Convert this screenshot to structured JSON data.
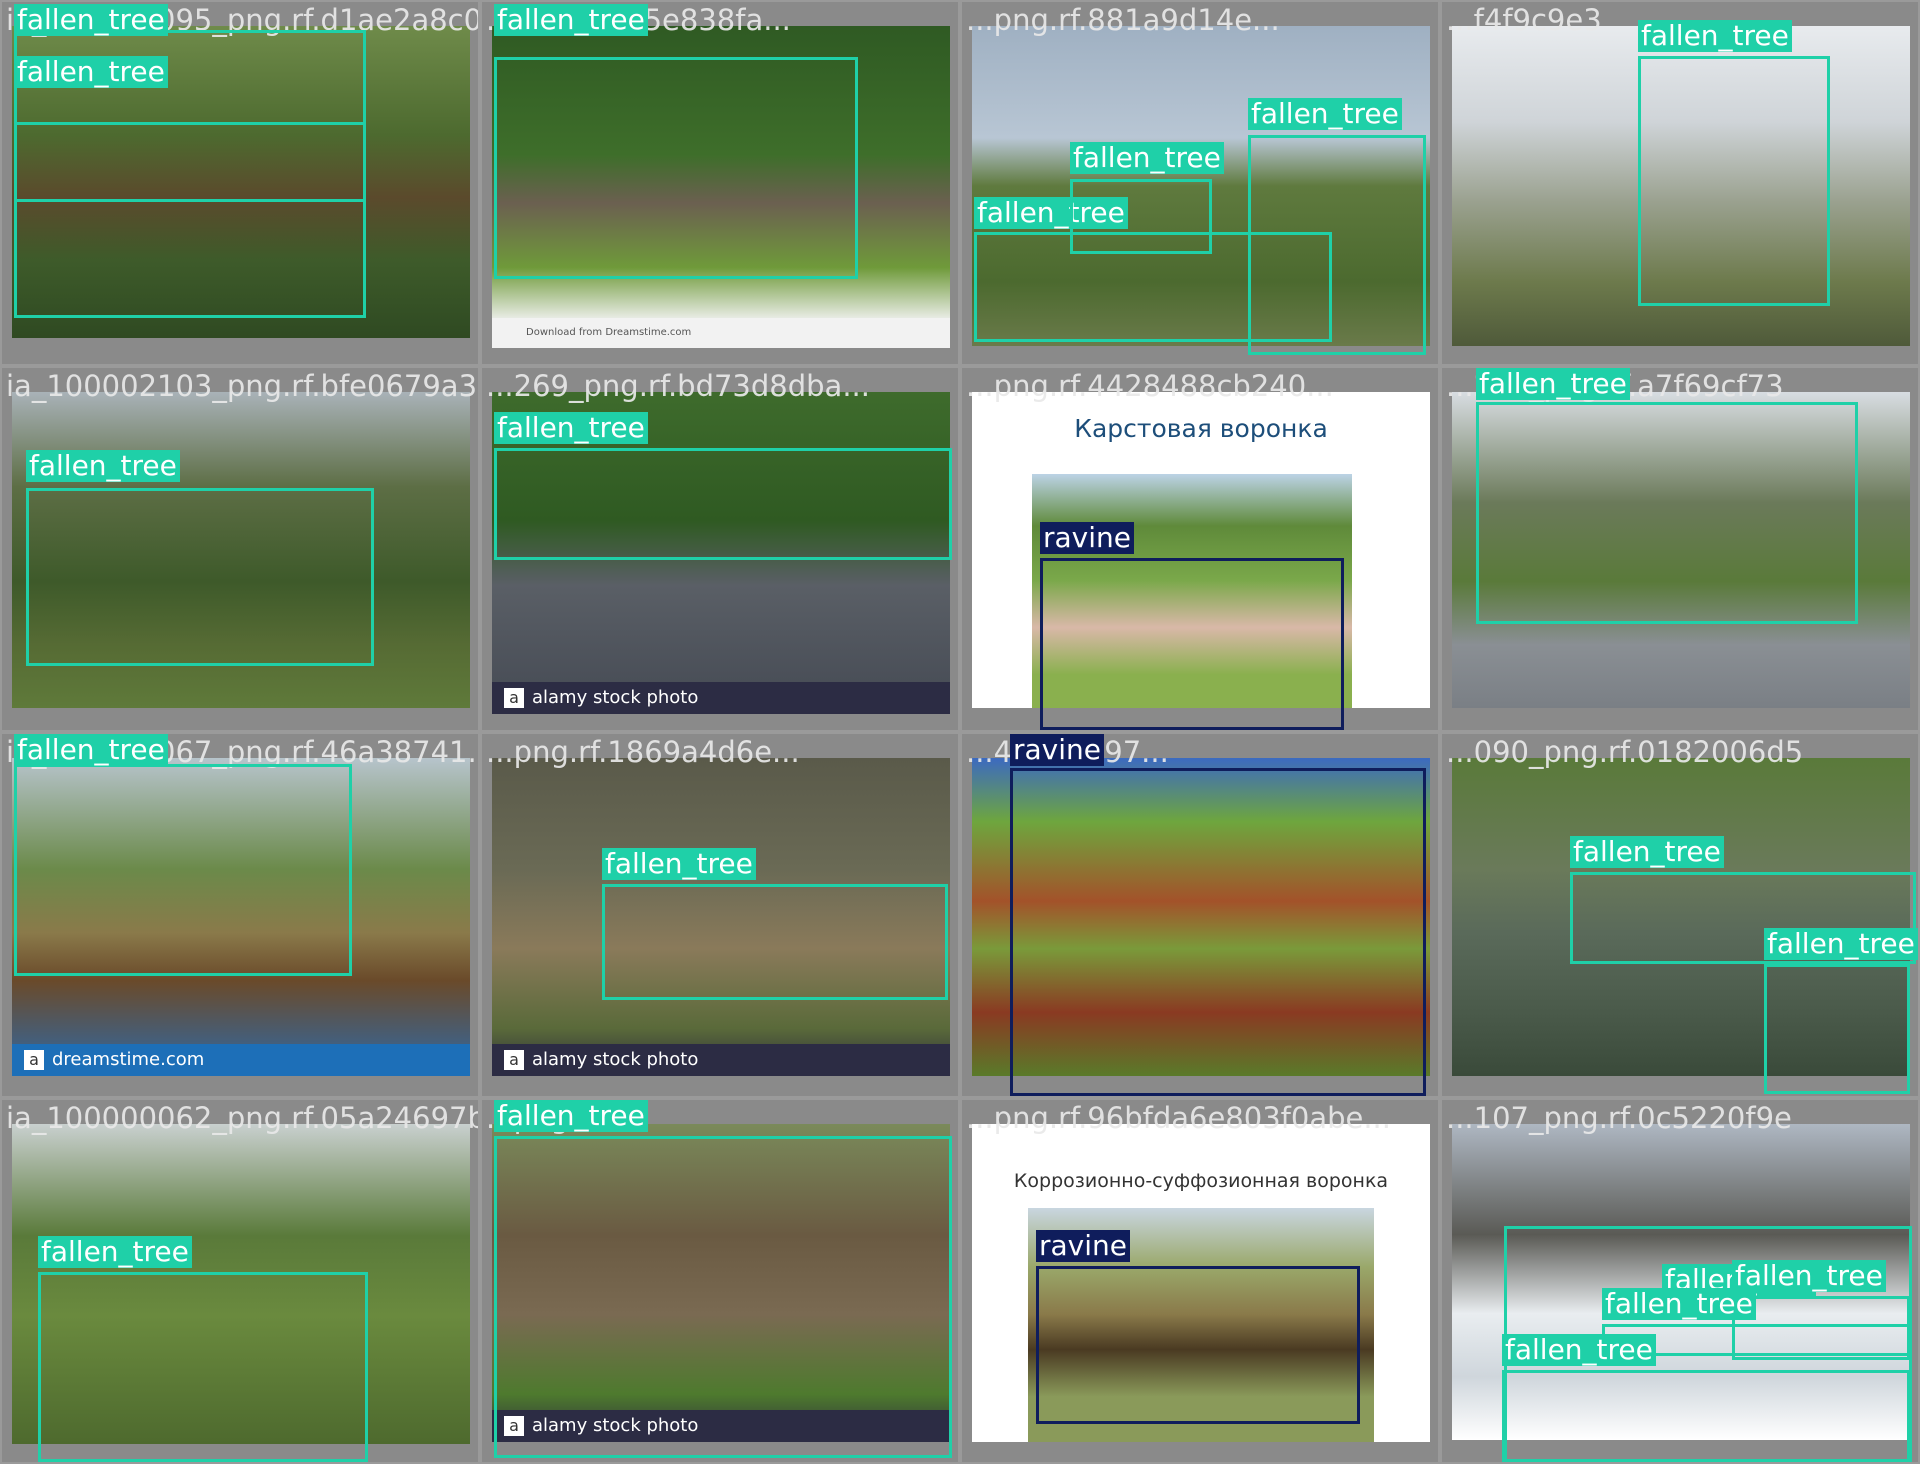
{
  "colors": {
    "fallen_tree": "#1fd0a8",
    "ravine": "#0f1d5c",
    "canvas": "#8a8a8a"
  },
  "tiles": [
    {
      "filename": "ia_100000095_png.rf.d1ae2a8c05...",
      "scene": "forest",
      "overlay_text": "fallen_tree fallen_tree",
      "watermark": "",
      "slide_title": "",
      "detections": [
        {
          "label": "fallen_tree"
        },
        {
          "label": "fallen_tree"
        }
      ]
    },
    {
      "filename": "...png.rf.e25e838fa...",
      "scene": "stump",
      "overlay_text": "Download from Dreamstime.com",
      "watermark": "",
      "slide_title": "",
      "detections": [
        {
          "label": "fallen_tree"
        }
      ]
    },
    {
      "filename": "...png.rf.881a9d14e...",
      "scene": "storm",
      "overlay_text": "",
      "watermark": "",
      "slide_title": "",
      "detections": [
        {
          "label": "fallen_tree"
        },
        {
          "label": "fallen_tree"
        },
        {
          "label": "fallen_tree"
        }
      ]
    },
    {
      "filename": "...f4f9c9e3",
      "scene": "street",
      "overlay_text": "",
      "watermark": "",
      "slide_title": "",
      "detections": [
        {
          "label": "fallen_tree"
        }
      ]
    },
    {
      "filename": "ia_100002103_png.rf.bfe0679a36...",
      "scene": "garden",
      "overlay_text": "",
      "watermark": "",
      "slide_title": "",
      "detections": [
        {
          "label": "fallen_tree"
        }
      ]
    },
    {
      "filename": "...269_png.rf.bd73d8dba...",
      "scene": "road",
      "overlay_text": "",
      "watermark": "alamy stock photo",
      "slide_title": "",
      "detections": [
        {
          "label": "fallen_tree"
        }
      ]
    },
    {
      "filename": "...png.rf.4428488cb240...",
      "scene": "slide-karst",
      "overlay_text": "",
      "watermark": "",
      "slide_title": "Карстовая воронка",
      "detections": [
        {
          "label": "ravine"
        }
      ]
    },
    {
      "filename": "...249_png.rf.a7f69cf73",
      "scene": "city",
      "overlay_text": "",
      "watermark": "",
      "slide_title": "",
      "detections": [
        {
          "label": "fallen_tree"
        }
      ]
    },
    {
      "filename": "ia_100000067_png.rf.46a38741...",
      "scene": "park",
      "overlay_text": "",
      "watermark": "dreamstime.com",
      "slide_title": "",
      "detections": [
        {
          "label": "fallen_tree"
        }
      ]
    },
    {
      "filename": "...png.rf.1869a4d6e...",
      "scene": "woods",
      "overlay_text": "",
      "watermark": "alamy stock photo",
      "slide_title": "",
      "detections": [
        {
          "label": "fallen_tree"
        }
      ]
    },
    {
      "filename": "...44db8297...",
      "scene": "gully",
      "overlay_text": "",
      "watermark": "",
      "slide_title": "",
      "detections": [
        {
          "label": "ravine"
        }
      ]
    },
    {
      "filename": "...090_png.rf.0182006d5",
      "scene": "river",
      "overlay_text": "",
      "watermark": "",
      "slide_title": "",
      "detections": [
        {
          "label": "fallen_tree"
        },
        {
          "label": "fallen_tree"
        }
      ]
    },
    {
      "filename": "ia_100000062_png.rf.05a24697b...",
      "scene": "lawn",
      "overlay_text": "",
      "watermark": "",
      "slide_title": "",
      "detections": [
        {
          "label": "fallen_tree"
        }
      ]
    },
    {
      "filename": "...png.rf.f...",
      "scene": "roots",
      "overlay_text": "",
      "watermark": "alamy stock photo",
      "slide_title": "",
      "detections": [
        {
          "label": "fallen_tree"
        }
      ]
    },
    {
      "filename": "...png.rf.96bfda6e803f0abe...",
      "scene": "slide-sinkhole",
      "overlay_text": "",
      "watermark": "",
      "slide_title": "Коррозионно-суффозионная воронка",
      "detections": [
        {
          "label": "ravine"
        }
      ]
    },
    {
      "filename": "...107_png.rf.0c5220f9e",
      "scene": "snow",
      "overlay_text": "",
      "watermark": "",
      "slide_title": "",
      "detections": [
        {
          "label": "fallen_tree"
        },
        {
          "label": "fallen_tree"
        },
        {
          "label": "fallen_tree"
        },
        {
          "label": "fallen_tree"
        }
      ]
    }
  ]
}
